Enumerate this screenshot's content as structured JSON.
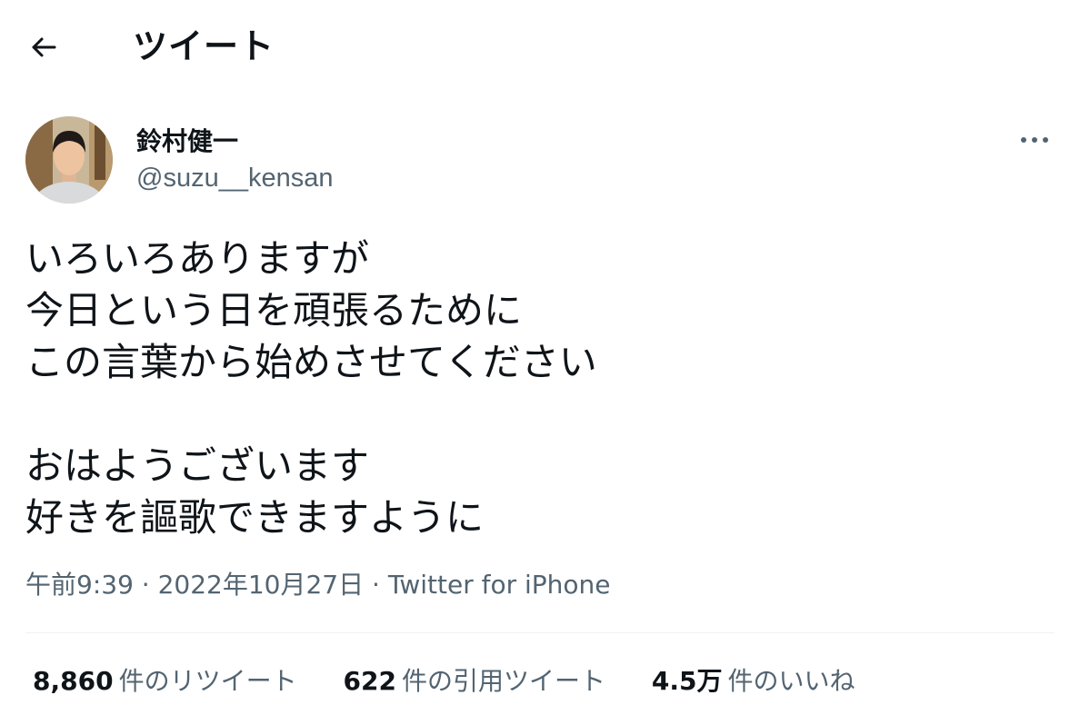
{
  "header": {
    "title": "ツイート",
    "back_icon": "arrow-left-icon"
  },
  "tweet": {
    "author": {
      "display_name": "鈴村健一",
      "handle": "@suzu__kensan",
      "avatar": "avatar-photo"
    },
    "more_icon": "more-horizontal-icon",
    "text": "いろいろありますが\n今日という日を頑張るために\nこの言葉から始めさせてください\n\nおはようございます\n好きを謳歌できますように",
    "time": "午前9:39",
    "separator": "·",
    "date": "2022年10月27日",
    "source": "Twitter for iPhone"
  },
  "stats": {
    "retweets": {
      "count": "8,860",
      "label": "件のリツイート"
    },
    "quotes": {
      "count": "622",
      "label": "件の引用ツイート"
    },
    "likes": {
      "count": "4.5万",
      "label": "件のいいね"
    }
  },
  "colors": {
    "text": "#0f1419",
    "secondary": "#536471",
    "divider": "#eff3f4"
  }
}
